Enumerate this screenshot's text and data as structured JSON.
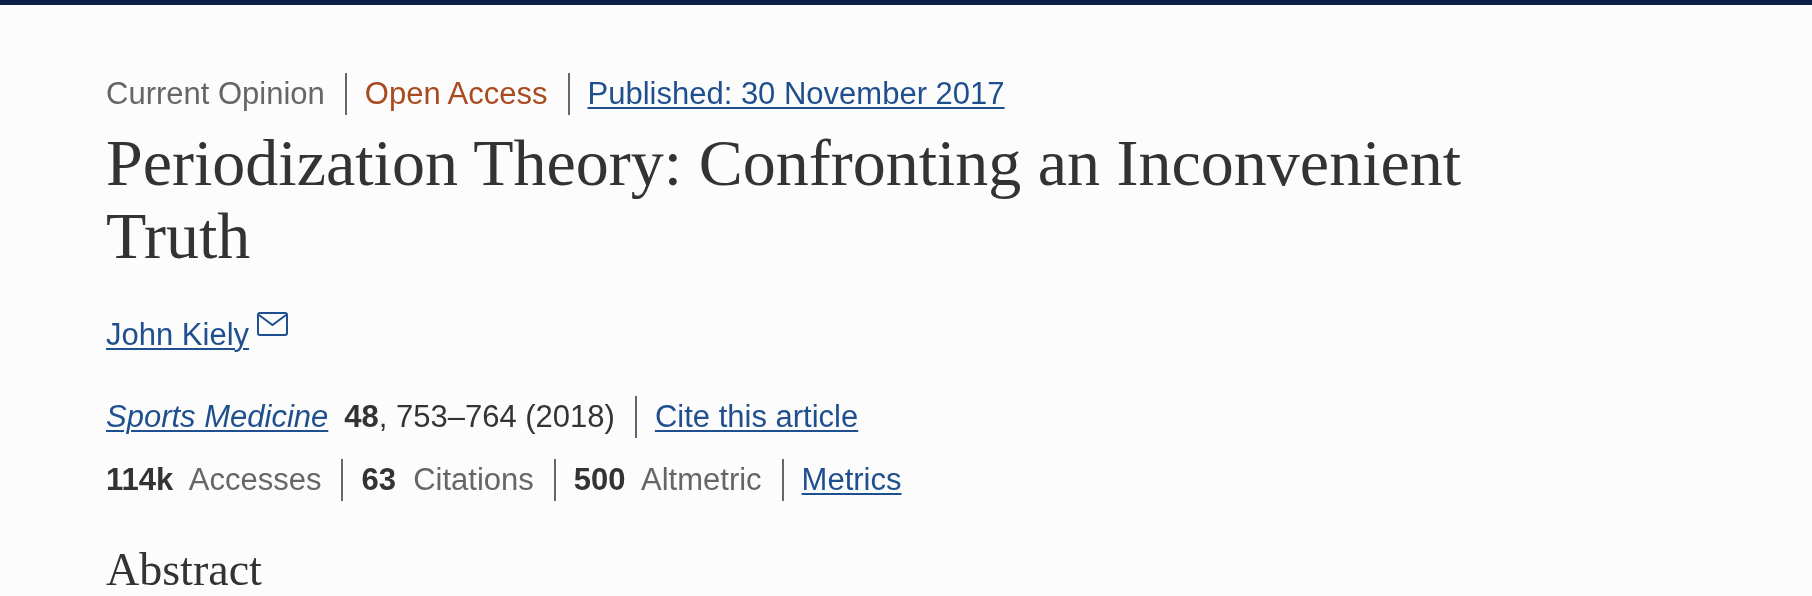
{
  "article_type": "Current Opinion",
  "access": "Open Access",
  "published": "Published: 30 November 2017",
  "title": "Periodization Theory: Confronting an Inconvenient Truth",
  "authors": [
    {
      "name": "John Kiely"
    }
  ],
  "citation": {
    "journal": "Sports Medicine",
    "details": "**48**, 753–764 (2018)",
    "cite_link": "Cite this article"
  },
  "metrics": [
    {
      "stat": "**114k**  Accesses"
    },
    {
      "stat": "**63**  Citations"
    },
    {
      "stat": "**500**  Altmetric"
    }
  ],
  "metrics_link": "Metrics",
  "section_heading": "Abstract"
}
